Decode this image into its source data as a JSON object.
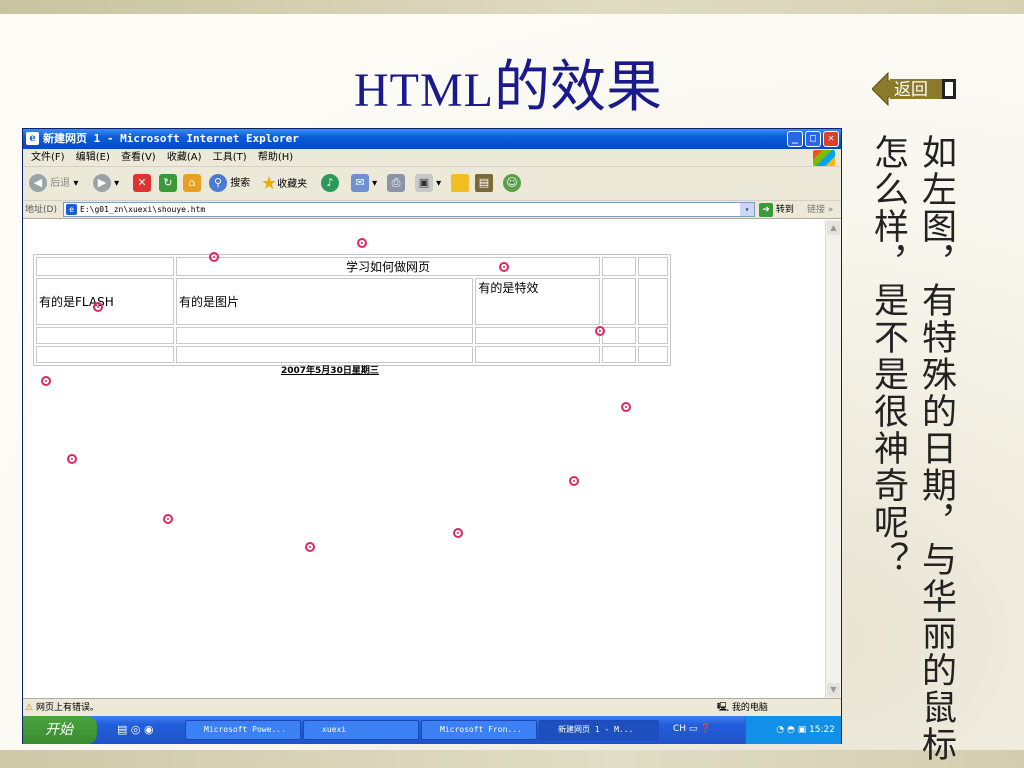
{
  "slide": {
    "title_latin": "HTML",
    "title_cjk": "的效果",
    "back_label": "返回",
    "right_col_text": "如左图，有特殊的日期，与华丽的鼠标",
    "left_col_text": "怎么样，是不是很神奇呢？"
  },
  "window": {
    "title": "新建网页 1 - Microsoft Internet Explorer",
    "menu": [
      "文件(F)",
      "编辑(E)",
      "查看(V)",
      "收藏(A)",
      "工具(T)",
      "帮助(H)"
    ],
    "toolbar": {
      "back": "后退",
      "search": "搜索",
      "favorites": "收藏夹"
    },
    "address_label": "地址(D)",
    "address_value": "E:\\g01_zn\\xuexi\\shouye.htm",
    "go_label": "转到",
    "links_label": "链接",
    "status_left": "网页上有错误。",
    "status_right": "我的电脑"
  },
  "page": {
    "table_title": "学习如何做网页",
    "cell_flash": "有的是FLASH",
    "cell_image": "有的是图片",
    "cell_effect": "有的是特效",
    "date": "2007年5月30日星期三"
  },
  "taskbar": {
    "start": "开始",
    "tasks": [
      "Microsoft Powe...",
      "xuexi",
      "Microsoft Fron...",
      "新建网页 1 - M..."
    ],
    "lang": "CH",
    "time": "15:22"
  },
  "colors": {
    "title_blue": "#1a1a8c",
    "swirl": "#e0285d",
    "xp_blue": "#0a5ed7"
  },
  "icons": [
    "back-arrow-icon",
    "forward-arrow-icon",
    "stop-icon",
    "refresh-icon",
    "home-icon",
    "search-icon",
    "favorites-star-icon",
    "media-icon",
    "mail-icon",
    "print-icon",
    "edit-icon",
    "folder-icon",
    "messenger-icon",
    "swirl-cursor-trail-icon"
  ]
}
